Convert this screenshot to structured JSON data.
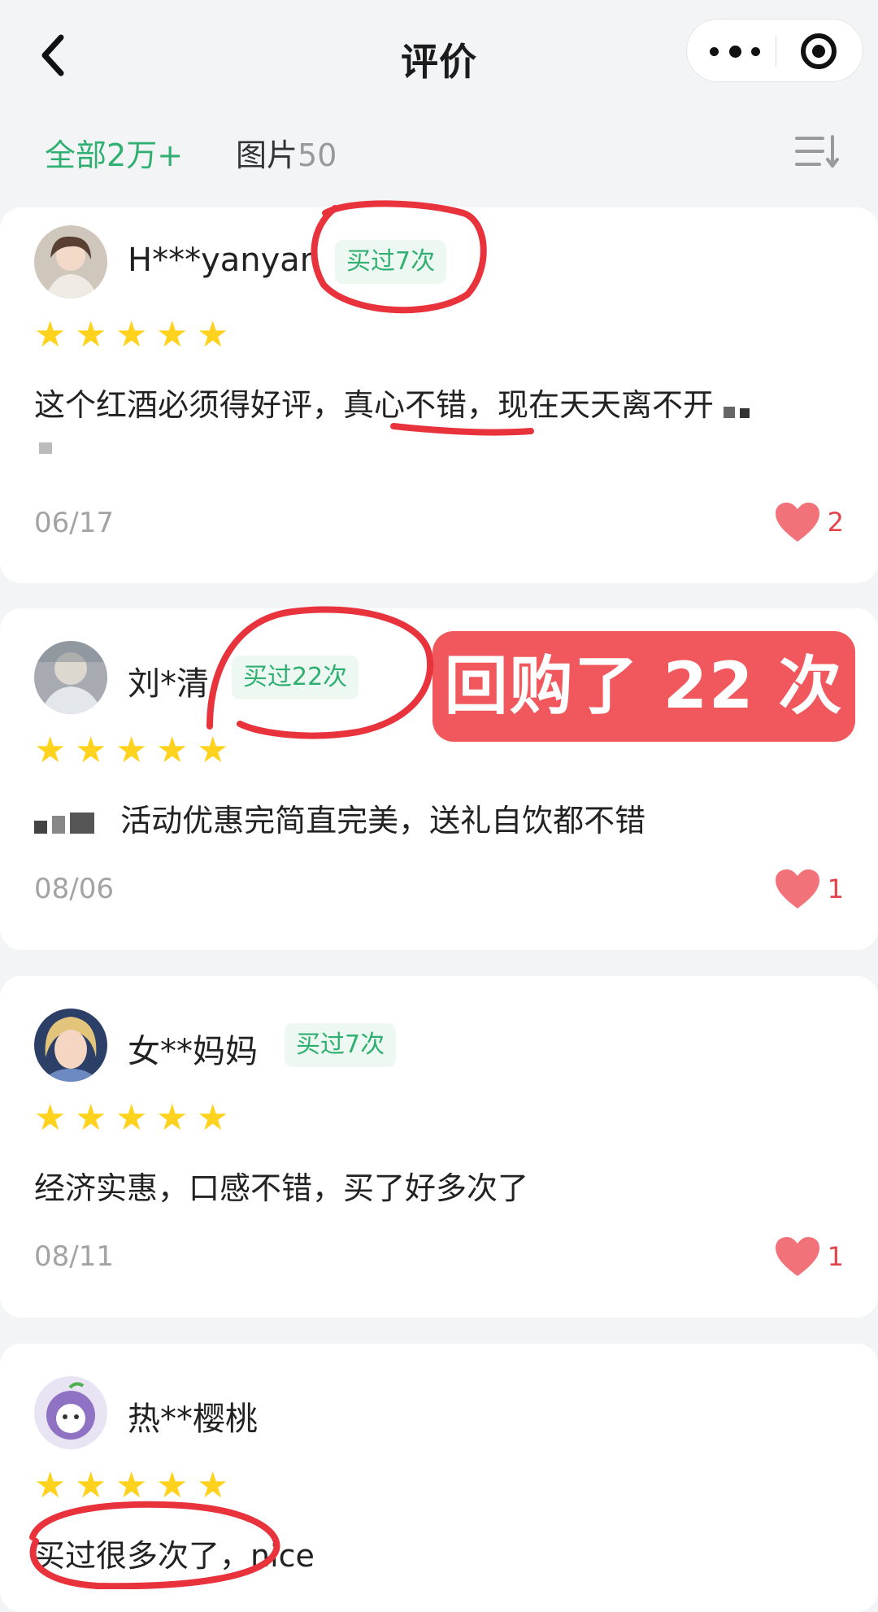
{
  "header": {
    "title": "评价",
    "back_icon": "chevron-left-icon",
    "more_icon": "more-dots-icon",
    "close_icon": "target-circle-icon"
  },
  "tabs": [
    {
      "label": "全部",
      "count": "2万+",
      "active": true
    },
    {
      "label": "图片",
      "count": "50",
      "active": false
    }
  ],
  "sort_icon": "sort-list-icon",
  "reviews": [
    {
      "user": "H***yanyan",
      "badge": "买过7次",
      "stars": 5,
      "text": "这个红酒必须得好评，真心不错，现在天天离不开",
      "date": "06/17",
      "likes": "2"
    },
    {
      "user": "刘*清",
      "badge": "买过22次",
      "stars": 5,
      "text": "活动优惠完简直完美，送礼自饮都不错",
      "date": "08/06",
      "likes": "1"
    },
    {
      "user": "女**妈妈",
      "badge": "买过7次",
      "stars": 5,
      "text": "经济实惠，口感不错，买了好多次了",
      "date": "08/11",
      "likes": "1"
    },
    {
      "user": "热**樱桃",
      "badge": "",
      "stars": 5,
      "text": "买过很多次了，nice",
      "date": "",
      "likes": ""
    }
  ],
  "stamp_label": "回购了 22 次",
  "colors": {
    "accent": "#2fb071",
    "badge_bg": "#eef8f2",
    "like": "#e2444c",
    "star": "#ffd21e",
    "stamp": "#f0585d"
  }
}
